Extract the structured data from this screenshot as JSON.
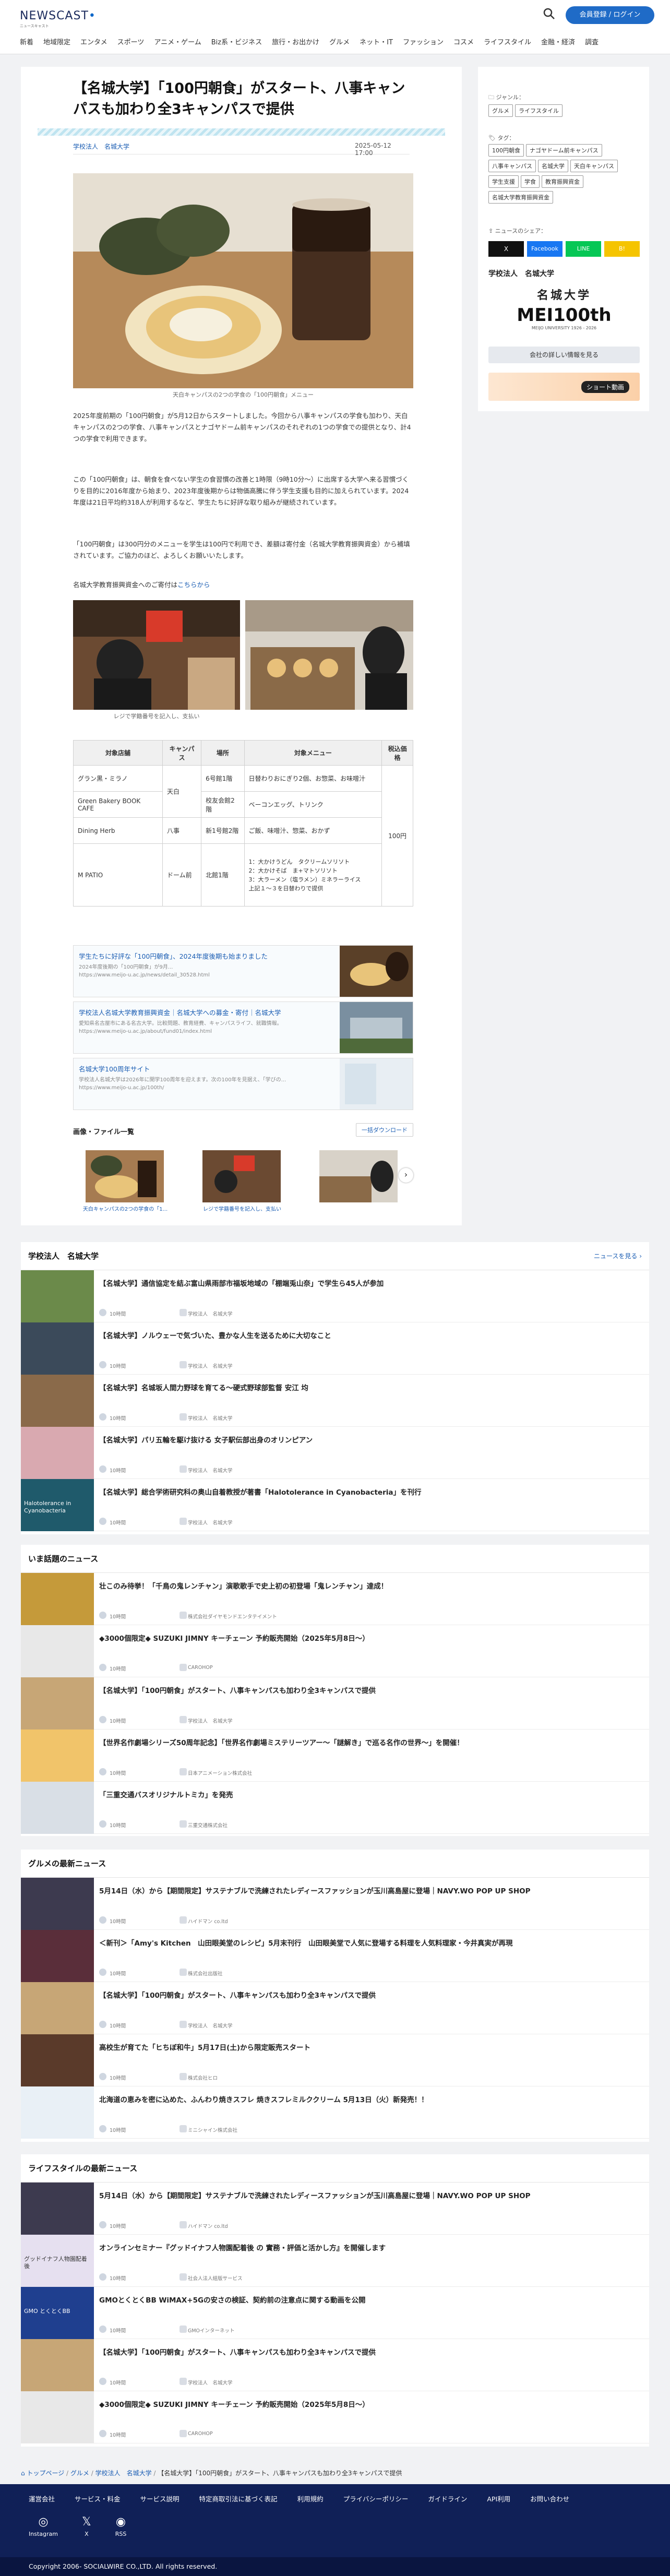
{
  "header": {
    "logo": "NEWSCAST",
    "logo_sub": "ニュースキャスト",
    "login": "会員登録 / ログイン",
    "nav": [
      "新着",
      "地域限定",
      "エンタメ",
      "スポーツ",
      "アニメ・ゲーム",
      "Biz系・ビジネス",
      "旅行・お出かけ",
      "グルメ",
      "ネット・IT",
      "ファッション",
      "コスメ",
      "ライフスタイル",
      "金融・経済",
      "調査"
    ]
  },
  "article": {
    "title": "【名城大学】「100円朝食」がスタート、八事キャンパスも加わり全3キャンパスで提供",
    "source": "学校法人　名城大学",
    "date": "2025-05-12 17:00",
    "main_caption": "天白キャンパスの2つの学食の「100円朝食」メニュー",
    "para1": "2025年度前期の「100円朝食」が5月12日からスタートしました。今回から八事キャンパスの学食も加わり、天白キャンパスの2つの学食、八事キャンパスとナゴヤドーム前キャンパスのそれぞれの1つの学食での提供となり、計4つの学食で利用できます。",
    "para2": "この「100円朝食」は、朝食を食べない学生の食習慣の改善と1時限（9時10分～）に出席する大学へ来る習慣づくりを目的に2016年度から始まり、2023年度後期からは物価高騰に伴う学生支援も目的に加えられています。2024年度は21日平均約318人が利用するなど、学生たちに好評な取り組みが継続されています。",
    "para3": "「100円朝食」は300円分のメニューを学生は100円で利用でき、差額は寄付金（名城大学教育振興資金）から補填されています。ご協力のほど、よろしくお願いいたします。",
    "para4_prefix": "名城大学教育振興資金へのご寄付は",
    "para4_link": "こちらから",
    "photo_caption": "レジで学籍番号を記入し、支払い",
    "table": {
      "headers": [
        "対象店舗",
        "キャンパス",
        "場所",
        "対象メニュー",
        "税込価格"
      ],
      "rows": [
        [
          "グラン黒・ミラノ",
          "天白",
          "6号館1階",
          "日替わりおにぎり2個、お惣菜、お味噌汁"
        ],
        [
          "Green Bakery BOOK CAFE",
          "",
          "校友会館2階",
          "ベーコンエッグ、トリンク"
        ],
        [
          "Dining Herb",
          "八事",
          "新1号館2階",
          "ご飯、味噌汁、惣菜、おかず"
        ],
        [
          "M PATIO",
          "ドーム前",
          "北館1階",
          "1：大かけうどん　タクリームソリソト\n2：大かけそば　ま+マトソリソト\n3：大ラーメン（塩ラメン）ミネラーライス\n上記１～３を日替わりで提供"
        ]
      ],
      "price": "100円"
    },
    "links": [
      {
        "title": "学生たちに好評な「100円朝食」、2024年度後期も始まりました",
        "sub": "2024年度後期の「100円朝食」が9月...\nhttps://www.meijo-u.ac.jp/news/detail_30528.html"
      },
      {
        "title": "学校法人名城大学教育振興資金｜名城大学への募金・寄付｜名城大学",
        "sub": "愛知県名古屋市にある名古大学。比較問題、教育経費、キャンパスライフ、就職情報。\nhttps://www.meijo-u.ac.jp/about/fund01/index.html"
      },
      {
        "title": "名城大学100周年サイト",
        "sub": "学校法人名城大学は2026年に開学100周年を迎えます。次の100年を見据え、「学びの...\nhttps://www.meijo-u.ac.jp/100th/"
      }
    ],
    "files": {
      "title": "画像・ファイル一覧",
      "download": "一括ダウンロード",
      "captions": [
        "天白キャンパスの2つの学食の「1...",
        "レジで学籍番号を記入し、支払い",
        ""
      ]
    }
  },
  "sidebar": {
    "genre_label": "ジャンル：",
    "genres": [
      "グルメ",
      "ライフスタイル"
    ],
    "tag_label": "タグ：",
    "tags": [
      "100円朝食",
      "ナゴヤドーム前キャンパス",
      "八事キャンパス",
      "名城大学",
      "天白キャンパス",
      "学生支援",
      "学食",
      "教育振興資金",
      "名城大学教育振興資金"
    ],
    "share_label": "ニュースのシェア：",
    "share": [
      "X",
      "Facebook",
      "LINE",
      "B!"
    ],
    "org": "学校法人　名城大学",
    "org_logo_top": "名城大学",
    "org_logo_main": "MEI100th",
    "org_logo_sub": "MEIJO UNIVERSITY 1926 - 2026",
    "org_btn": "会社の詳しい情報を見る",
    "banner": "ショート動画"
  },
  "sections": [
    {
      "title": "学校法人　名城大学",
      "more": "ニュースを見る",
      "items": [
        {
          "title": "【名城大学】通信協定を結ぶ富山県雨部市福坂地域の「棚端兎山奈」で学生ら45人が参加",
          "company": "学校法人　名城大学",
          "color": "#6b8a4a"
        },
        {
          "title": "【名城大学】ノルウェーで気づいた、豊かな人生を送るために大切なこと",
          "company": "学校法人　名城大学",
          "color": "#3b4a5a"
        },
        {
          "title": "【名城大学】名城坂人間力野球を育てる～硬式野球部監督 安江 均",
          "company": "学校法人　名城大学",
          "color": "#8a6a4a"
        },
        {
          "title": "【名城大学】パリ五輪を駆け抜ける 女子駅伝部出身のオリンピアン",
          "company": "学校法人　名城大学",
          "color": "#d9a9b0"
        },
        {
          "title": "【名城大学】総合学術研究科の奥山自着教授が著書「Halotolerance in Cyanobacteria」を刊行",
          "company": "学校法人　名城大学",
          "color": "#1f5a6b",
          "thumb_text": "Halotolerance in Cyanobacteria"
        }
      ]
    },
    {
      "title": "いま話題のニュース",
      "more": "",
      "items": [
        {
          "title": "壮このみ待挙！「千鳥の鬼レンチャン」演歌歌手で史上初の初登場「鬼レンチャン」達成！",
          "company": "株式会社ダイヤモンドエンタテイメント",
          "color": "#c59a3a"
        },
        {
          "title": "◆3000個限定◆ SUZUKI JIMNY キーチェーン 予約販売開始（2025年5月8日〜）",
          "company": "CAROHOP",
          "color": "#e8e8e8"
        },
        {
          "title": "【名城大学】「100円朝食」がスタート、八事キャンパスも加わり全3キャンパスで提供",
          "company": "学校法人　名城大学",
          "color": "#c7a676"
        },
        {
          "title": "【世界名作劇場シリーズ50周年記念】「世界名作劇場ミステリーツアー〜「謎解き」で巡る名作の世界〜」を開催！",
          "company": "日本アニメーション株式会社",
          "color": "#f1c46a"
        },
        {
          "title": "「三重交通バスオリジナルトミカ」を発売",
          "company": "三重交通株式会社",
          "color": "#d9dfe6"
        }
      ]
    },
    {
      "title": "グルメの最新ニュース",
      "more": "",
      "items": [
        {
          "title": "5月14日（水）から【期間限定】サステナブルで洗練されたレディースファッションが玉川高島屋に登場｜NAVY.WO POP UP SHOP",
          "company": "ハイドマン co.ltd",
          "color": "#3d3a4f"
        },
        {
          "title": "＜新刊＞「Amy's Kitchen　山田眼美堂のレシピ」5月末刊行　山田眼美堂で人気に登場する料理を人気料理家・今井真実が再現",
          "company": "株式会社出版社",
          "color": "#5a2e3a"
        },
        {
          "title": "【名城大学】「100円朝食」がスタート、八事キャンパスも加わり全3キャンパスで提供",
          "company": "学校法人　名城大学",
          "color": "#c7a676"
        },
        {
          "title": "高校生が育てた「ヒちぼ和牛」5月17日(土)から限定販売スタート",
          "company": "株式会社ヒロ",
          "color": "#5a3a2a"
        },
        {
          "title": "北海道の恵みを密に込めた、ふんわり焼きスフレ 焼きスフレミルククリーム 5月13日（火）新発売！！",
          "company": "ミニシャイン株式会社",
          "color": "#e9f0f6"
        }
      ]
    },
    {
      "title": "ライフスタイルの最新ニュース",
      "more": "",
      "items": [
        {
          "title": "5月14日（水）から【期間限定】サステナブルで洗練されたレディースファッションが玉川高島屋に登場｜NAVY.WO POP UP SHOP",
          "company": "ハイドマン co.ltd",
          "color": "#3d3a4f"
        },
        {
          "title": "オンラインセミナー『グッドイナフ人物園配着後 の 實務・評価と活かし方』を開催します",
          "company": "社会人法人組版サービス",
          "color": "#e6e0f0",
          "thumb_text": "グッドイナフ人物園配着後"
        },
        {
          "title": "GMOとくとくBB WiMAX+5Gの安さの検証、契約前の注意点に関する動画を公開",
          "company": "GMOインターネット",
          "color": "#1f3f8f",
          "thumb_text": "GMO とくとくBB"
        },
        {
          "title": "【名城大学】「100円朝食」がスタート、八事キャンパスも加わり全3キャンパスで提供",
          "company": "学校法人　名城大学",
          "color": "#c7a676"
        },
        {
          "title": "◆3000個限定◆ SUZUKI JIMNY キーチェーン 予約販売開始（2025年5月8日〜）",
          "company": "CAROHOP",
          "color": "#e8e8e8"
        }
      ]
    }
  ],
  "item_meta_label": "10時間",
  "breadcrumb": [
    "トップページ",
    "グルメ",
    "学校法人　名城大学",
    "【名城大学】「100円朝食」がスタート、八事キャンパスも加わり全3キャンパスで提供"
  ],
  "footer": {
    "links": [
      "運営会社",
      "サービス・料金",
      "サービス説明",
      "特定商取引法に基づく表記",
      "利用規約",
      "プライバシーポリシー",
      "ガイドライン",
      "API利用",
      "お問い合わせ"
    ],
    "social": [
      "Instagram",
      "X",
      "RSS"
    ],
    "copyright": "Copyright 2006- SOCIALWIRE CO.,LTD. All rights reserved."
  }
}
